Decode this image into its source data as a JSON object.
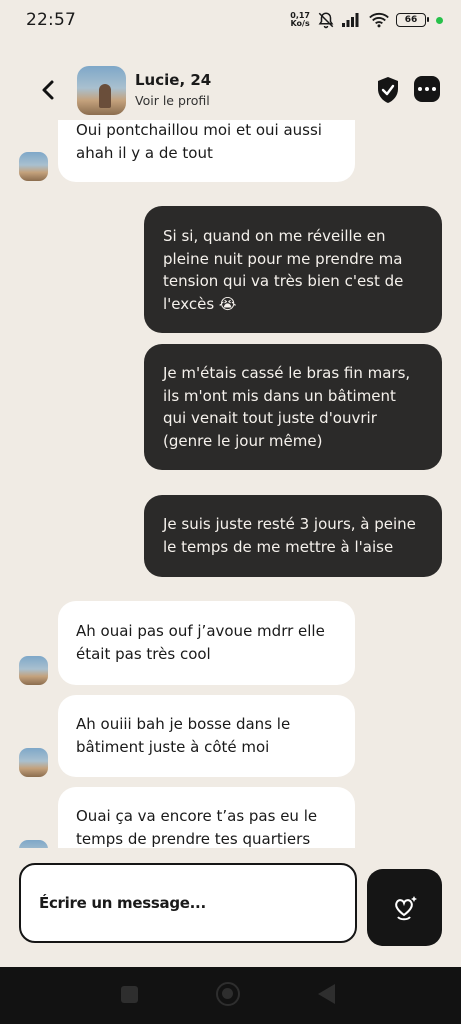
{
  "status_bar": {
    "time": "22:57",
    "net_speed_value": "0,17",
    "net_speed_unit": "Ko/s",
    "battery": "66"
  },
  "header": {
    "name": "Lucie, 24",
    "subtitle": "Voir le profil"
  },
  "messages": [
    {
      "direction": "in",
      "text": "Oui pontchaillou moi et oui aussi ahah il y a de tout"
    },
    {
      "direction": "out",
      "text": "Si si, quand on me réveille en pleine nuit pour me prendre ma tension qui va très bien c'est de l'excès 😭"
    },
    {
      "direction": "out",
      "text": "Je m'étais cassé le bras fin mars, ils m'ont mis dans un bâtiment qui venait tout juste d'ouvrir (genre le jour même)"
    },
    {
      "direction": "out",
      "text": "Je suis juste resté 3 jours, à peine le temps de me mettre à l'aise"
    },
    {
      "direction": "in",
      "text": "Ah ouai pas ouf j’avoue mdrr elle était pas très cool"
    },
    {
      "direction": "in",
      "text": "Ah ouiii bah je bosse dans le bâtiment juste à côté moi"
    },
    {
      "direction": "in",
      "text": "Ouai ça va encore t’as pas eu le temps de prendre tes quartiers"
    }
  ],
  "composer": {
    "placeholder": "Écrire un message..."
  },
  "icons": {
    "back": "chevron-left-icon",
    "shield": "shield-check-icon",
    "more": "more-horizontal-icon",
    "send": "heart-sparkle-icon"
  },
  "colors": {
    "background": "#f0ebe4",
    "incoming_bubble": "#ffffff",
    "outgoing_bubble": "#2b2a29",
    "accent_dark": "#151515"
  }
}
